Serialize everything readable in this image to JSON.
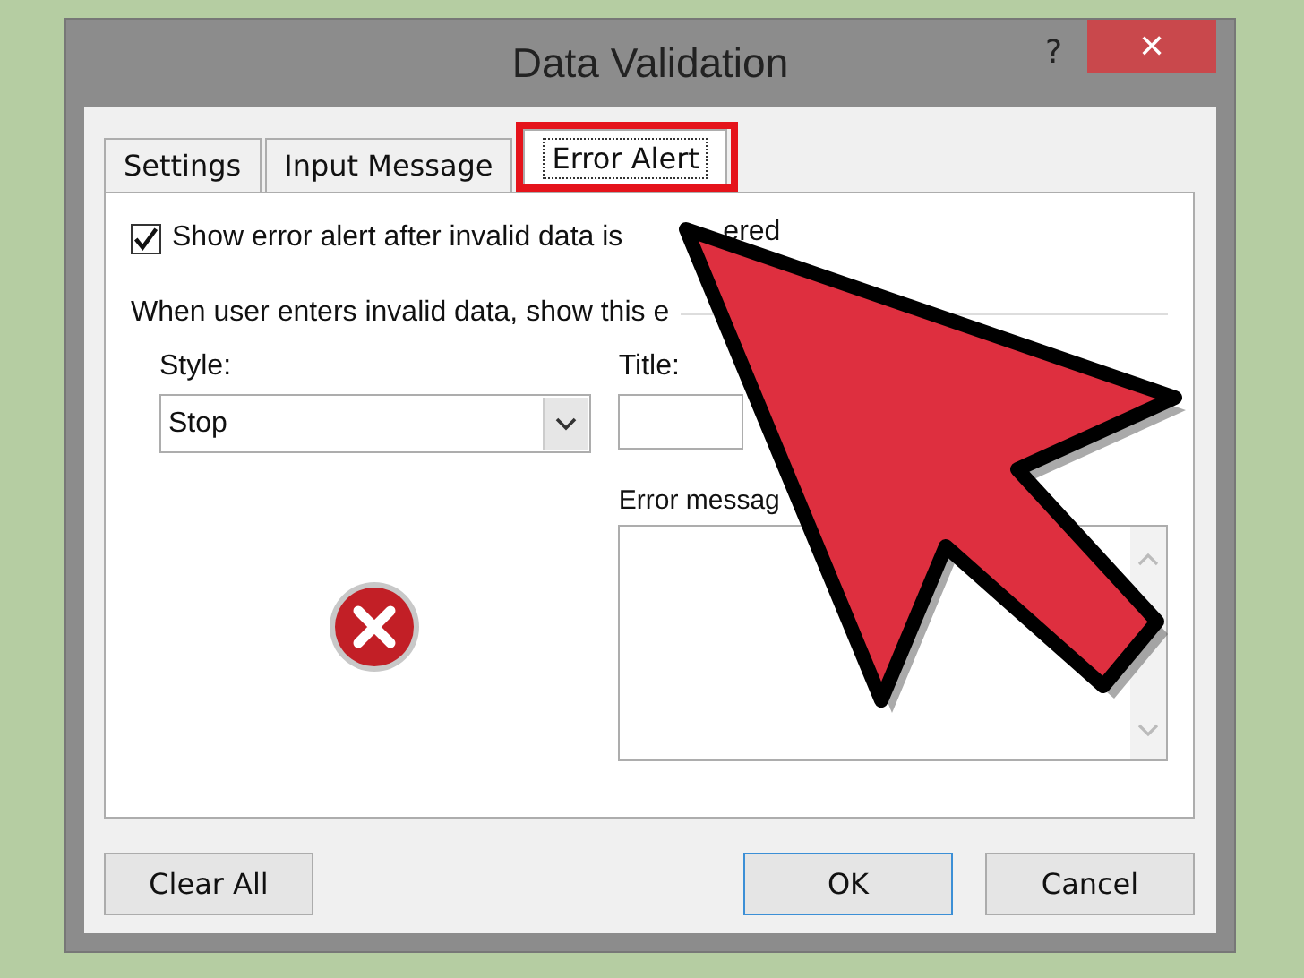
{
  "window": {
    "title": "Data Validation",
    "help": "?",
    "close": "✕"
  },
  "tabs": [
    {
      "label": "Settings",
      "selected": false,
      "highlighted": false
    },
    {
      "label": "Input Message",
      "selected": false,
      "highlighted": false
    },
    {
      "label": "Error Alert",
      "selected": true,
      "highlighted": true
    }
  ],
  "show_alert": {
    "label": "Show error alert after invalid data is",
    "label_tail": "ered",
    "checked": true
  },
  "instruction": "When user enters invalid data, show this e",
  "style": {
    "label": "Style:",
    "value": "Stop"
  },
  "title_field": {
    "label": "Title:"
  },
  "error_message": {
    "label": "Error messag"
  },
  "buttons": [
    {
      "label": "Clear All",
      "default": false
    },
    {
      "label": "OK",
      "default": true
    },
    {
      "label": "Cancel",
      "default": false
    }
  ]
}
